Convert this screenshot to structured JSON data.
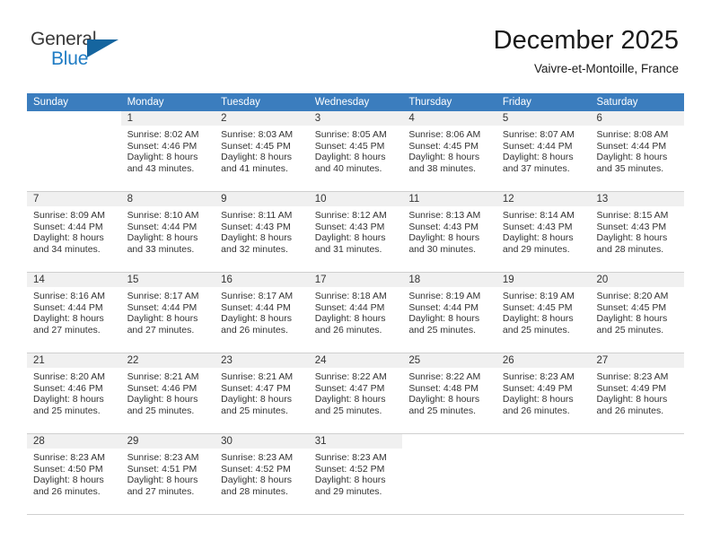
{
  "brand": {
    "name_part1": "General",
    "name_part2": "Blue",
    "triangle_icon": "triangle-icon",
    "color_dark": "#3a3a3a",
    "color_blue": "#1f7cc4",
    "color_triangle": "#15659f"
  },
  "header": {
    "month_title": "December 2025",
    "location": "Vaivre-et-Montoille, France"
  },
  "theme": {
    "header_bar": "#3b7dbe",
    "day_band": "#f0f0f0",
    "row_divider": "#cfcfcf",
    "text": "#333333"
  },
  "weekdays": [
    "Sunday",
    "Monday",
    "Tuesday",
    "Wednesday",
    "Thursday",
    "Friday",
    "Saturday"
  ],
  "weeks": [
    [
      {
        "day": "",
        "blank": true,
        "empty": true,
        "sunrise": "",
        "sunset": "",
        "daylight_line1": "",
        "daylight_line2": ""
      },
      {
        "day": "1",
        "sunrise": "Sunrise: 8:02 AM",
        "sunset": "Sunset: 4:46 PM",
        "daylight_line1": "Daylight: 8 hours",
        "daylight_line2": "and 43 minutes."
      },
      {
        "day": "2",
        "sunrise": "Sunrise: 8:03 AM",
        "sunset": "Sunset: 4:45 PM",
        "daylight_line1": "Daylight: 8 hours",
        "daylight_line2": "and 41 minutes."
      },
      {
        "day": "3",
        "sunrise": "Sunrise: 8:05 AM",
        "sunset": "Sunset: 4:45 PM",
        "daylight_line1": "Daylight: 8 hours",
        "daylight_line2": "and 40 minutes."
      },
      {
        "day": "4",
        "sunrise": "Sunrise: 8:06 AM",
        "sunset": "Sunset: 4:45 PM",
        "daylight_line1": "Daylight: 8 hours",
        "daylight_line2": "and 38 minutes."
      },
      {
        "day": "5",
        "sunrise": "Sunrise: 8:07 AM",
        "sunset": "Sunset: 4:44 PM",
        "daylight_line1": "Daylight: 8 hours",
        "daylight_line2": "and 37 minutes."
      },
      {
        "day": "6",
        "sunrise": "Sunrise: 8:08 AM",
        "sunset": "Sunset: 4:44 PM",
        "daylight_line1": "Daylight: 8 hours",
        "daylight_line2": "and 35 minutes."
      }
    ],
    [
      {
        "day": "7",
        "sunrise": "Sunrise: 8:09 AM",
        "sunset": "Sunset: 4:44 PM",
        "daylight_line1": "Daylight: 8 hours",
        "daylight_line2": "and 34 minutes."
      },
      {
        "day": "8",
        "sunrise": "Sunrise: 8:10 AM",
        "sunset": "Sunset: 4:44 PM",
        "daylight_line1": "Daylight: 8 hours",
        "daylight_line2": "and 33 minutes."
      },
      {
        "day": "9",
        "sunrise": "Sunrise: 8:11 AM",
        "sunset": "Sunset: 4:43 PM",
        "daylight_line1": "Daylight: 8 hours",
        "daylight_line2": "and 32 minutes."
      },
      {
        "day": "10",
        "sunrise": "Sunrise: 8:12 AM",
        "sunset": "Sunset: 4:43 PM",
        "daylight_line1": "Daylight: 8 hours",
        "daylight_line2": "and 31 minutes."
      },
      {
        "day": "11",
        "sunrise": "Sunrise: 8:13 AM",
        "sunset": "Sunset: 4:43 PM",
        "daylight_line1": "Daylight: 8 hours",
        "daylight_line2": "and 30 minutes."
      },
      {
        "day": "12",
        "sunrise": "Sunrise: 8:14 AM",
        "sunset": "Sunset: 4:43 PM",
        "daylight_line1": "Daylight: 8 hours",
        "daylight_line2": "and 29 minutes."
      },
      {
        "day": "13",
        "sunrise": "Sunrise: 8:15 AM",
        "sunset": "Sunset: 4:43 PM",
        "daylight_line1": "Daylight: 8 hours",
        "daylight_line2": "and 28 minutes."
      }
    ],
    [
      {
        "day": "14",
        "sunrise": "Sunrise: 8:16 AM",
        "sunset": "Sunset: 4:44 PM",
        "daylight_line1": "Daylight: 8 hours",
        "daylight_line2": "and 27 minutes."
      },
      {
        "day": "15",
        "sunrise": "Sunrise: 8:17 AM",
        "sunset": "Sunset: 4:44 PM",
        "daylight_line1": "Daylight: 8 hours",
        "daylight_line2": "and 27 minutes."
      },
      {
        "day": "16",
        "sunrise": "Sunrise: 8:17 AM",
        "sunset": "Sunset: 4:44 PM",
        "daylight_line1": "Daylight: 8 hours",
        "daylight_line2": "and 26 minutes."
      },
      {
        "day": "17",
        "sunrise": "Sunrise: 8:18 AM",
        "sunset": "Sunset: 4:44 PM",
        "daylight_line1": "Daylight: 8 hours",
        "daylight_line2": "and 26 minutes."
      },
      {
        "day": "18",
        "sunrise": "Sunrise: 8:19 AM",
        "sunset": "Sunset: 4:44 PM",
        "daylight_line1": "Daylight: 8 hours",
        "daylight_line2": "and 25 minutes."
      },
      {
        "day": "19",
        "sunrise": "Sunrise: 8:19 AM",
        "sunset": "Sunset: 4:45 PM",
        "daylight_line1": "Daylight: 8 hours",
        "daylight_line2": "and 25 minutes."
      },
      {
        "day": "20",
        "sunrise": "Sunrise: 8:20 AM",
        "sunset": "Sunset: 4:45 PM",
        "daylight_line1": "Daylight: 8 hours",
        "daylight_line2": "and 25 minutes."
      }
    ],
    [
      {
        "day": "21",
        "sunrise": "Sunrise: 8:20 AM",
        "sunset": "Sunset: 4:46 PM",
        "daylight_line1": "Daylight: 8 hours",
        "daylight_line2": "and 25 minutes."
      },
      {
        "day": "22",
        "sunrise": "Sunrise: 8:21 AM",
        "sunset": "Sunset: 4:46 PM",
        "daylight_line1": "Daylight: 8 hours",
        "daylight_line2": "and 25 minutes."
      },
      {
        "day": "23",
        "sunrise": "Sunrise: 8:21 AM",
        "sunset": "Sunset: 4:47 PM",
        "daylight_line1": "Daylight: 8 hours",
        "daylight_line2": "and 25 minutes."
      },
      {
        "day": "24",
        "sunrise": "Sunrise: 8:22 AM",
        "sunset": "Sunset: 4:47 PM",
        "daylight_line1": "Daylight: 8 hours",
        "daylight_line2": "and 25 minutes."
      },
      {
        "day": "25",
        "sunrise": "Sunrise: 8:22 AM",
        "sunset": "Sunset: 4:48 PM",
        "daylight_line1": "Daylight: 8 hours",
        "daylight_line2": "and 25 minutes."
      },
      {
        "day": "26",
        "sunrise": "Sunrise: 8:23 AM",
        "sunset": "Sunset: 4:49 PM",
        "daylight_line1": "Daylight: 8 hours",
        "daylight_line2": "and 26 minutes."
      },
      {
        "day": "27",
        "sunrise": "Sunrise: 8:23 AM",
        "sunset": "Sunset: 4:49 PM",
        "daylight_line1": "Daylight: 8 hours",
        "daylight_line2": "and 26 minutes."
      }
    ],
    [
      {
        "day": "28",
        "sunrise": "Sunrise: 8:23 AM",
        "sunset": "Sunset: 4:50 PM",
        "daylight_line1": "Daylight: 8 hours",
        "daylight_line2": "and 26 minutes."
      },
      {
        "day": "29",
        "sunrise": "Sunrise: 8:23 AM",
        "sunset": "Sunset: 4:51 PM",
        "daylight_line1": "Daylight: 8 hours",
        "daylight_line2": "and 27 minutes."
      },
      {
        "day": "30",
        "sunrise": "Sunrise: 8:23 AM",
        "sunset": "Sunset: 4:52 PM",
        "daylight_line1": "Daylight: 8 hours",
        "daylight_line2": "and 28 minutes."
      },
      {
        "day": "31",
        "sunrise": "Sunrise: 8:23 AM",
        "sunset": "Sunset: 4:52 PM",
        "daylight_line1": "Daylight: 8 hours",
        "daylight_line2": "and 29 minutes."
      },
      {
        "day": "",
        "blank": true,
        "sunrise": "",
        "sunset": "",
        "daylight_line1": "",
        "daylight_line2": ""
      },
      {
        "day": "",
        "blank": true,
        "sunrise": "",
        "sunset": "",
        "daylight_line1": "",
        "daylight_line2": ""
      },
      {
        "day": "",
        "blank": true,
        "sunrise": "",
        "sunset": "",
        "daylight_line1": "",
        "daylight_line2": ""
      }
    ]
  ]
}
